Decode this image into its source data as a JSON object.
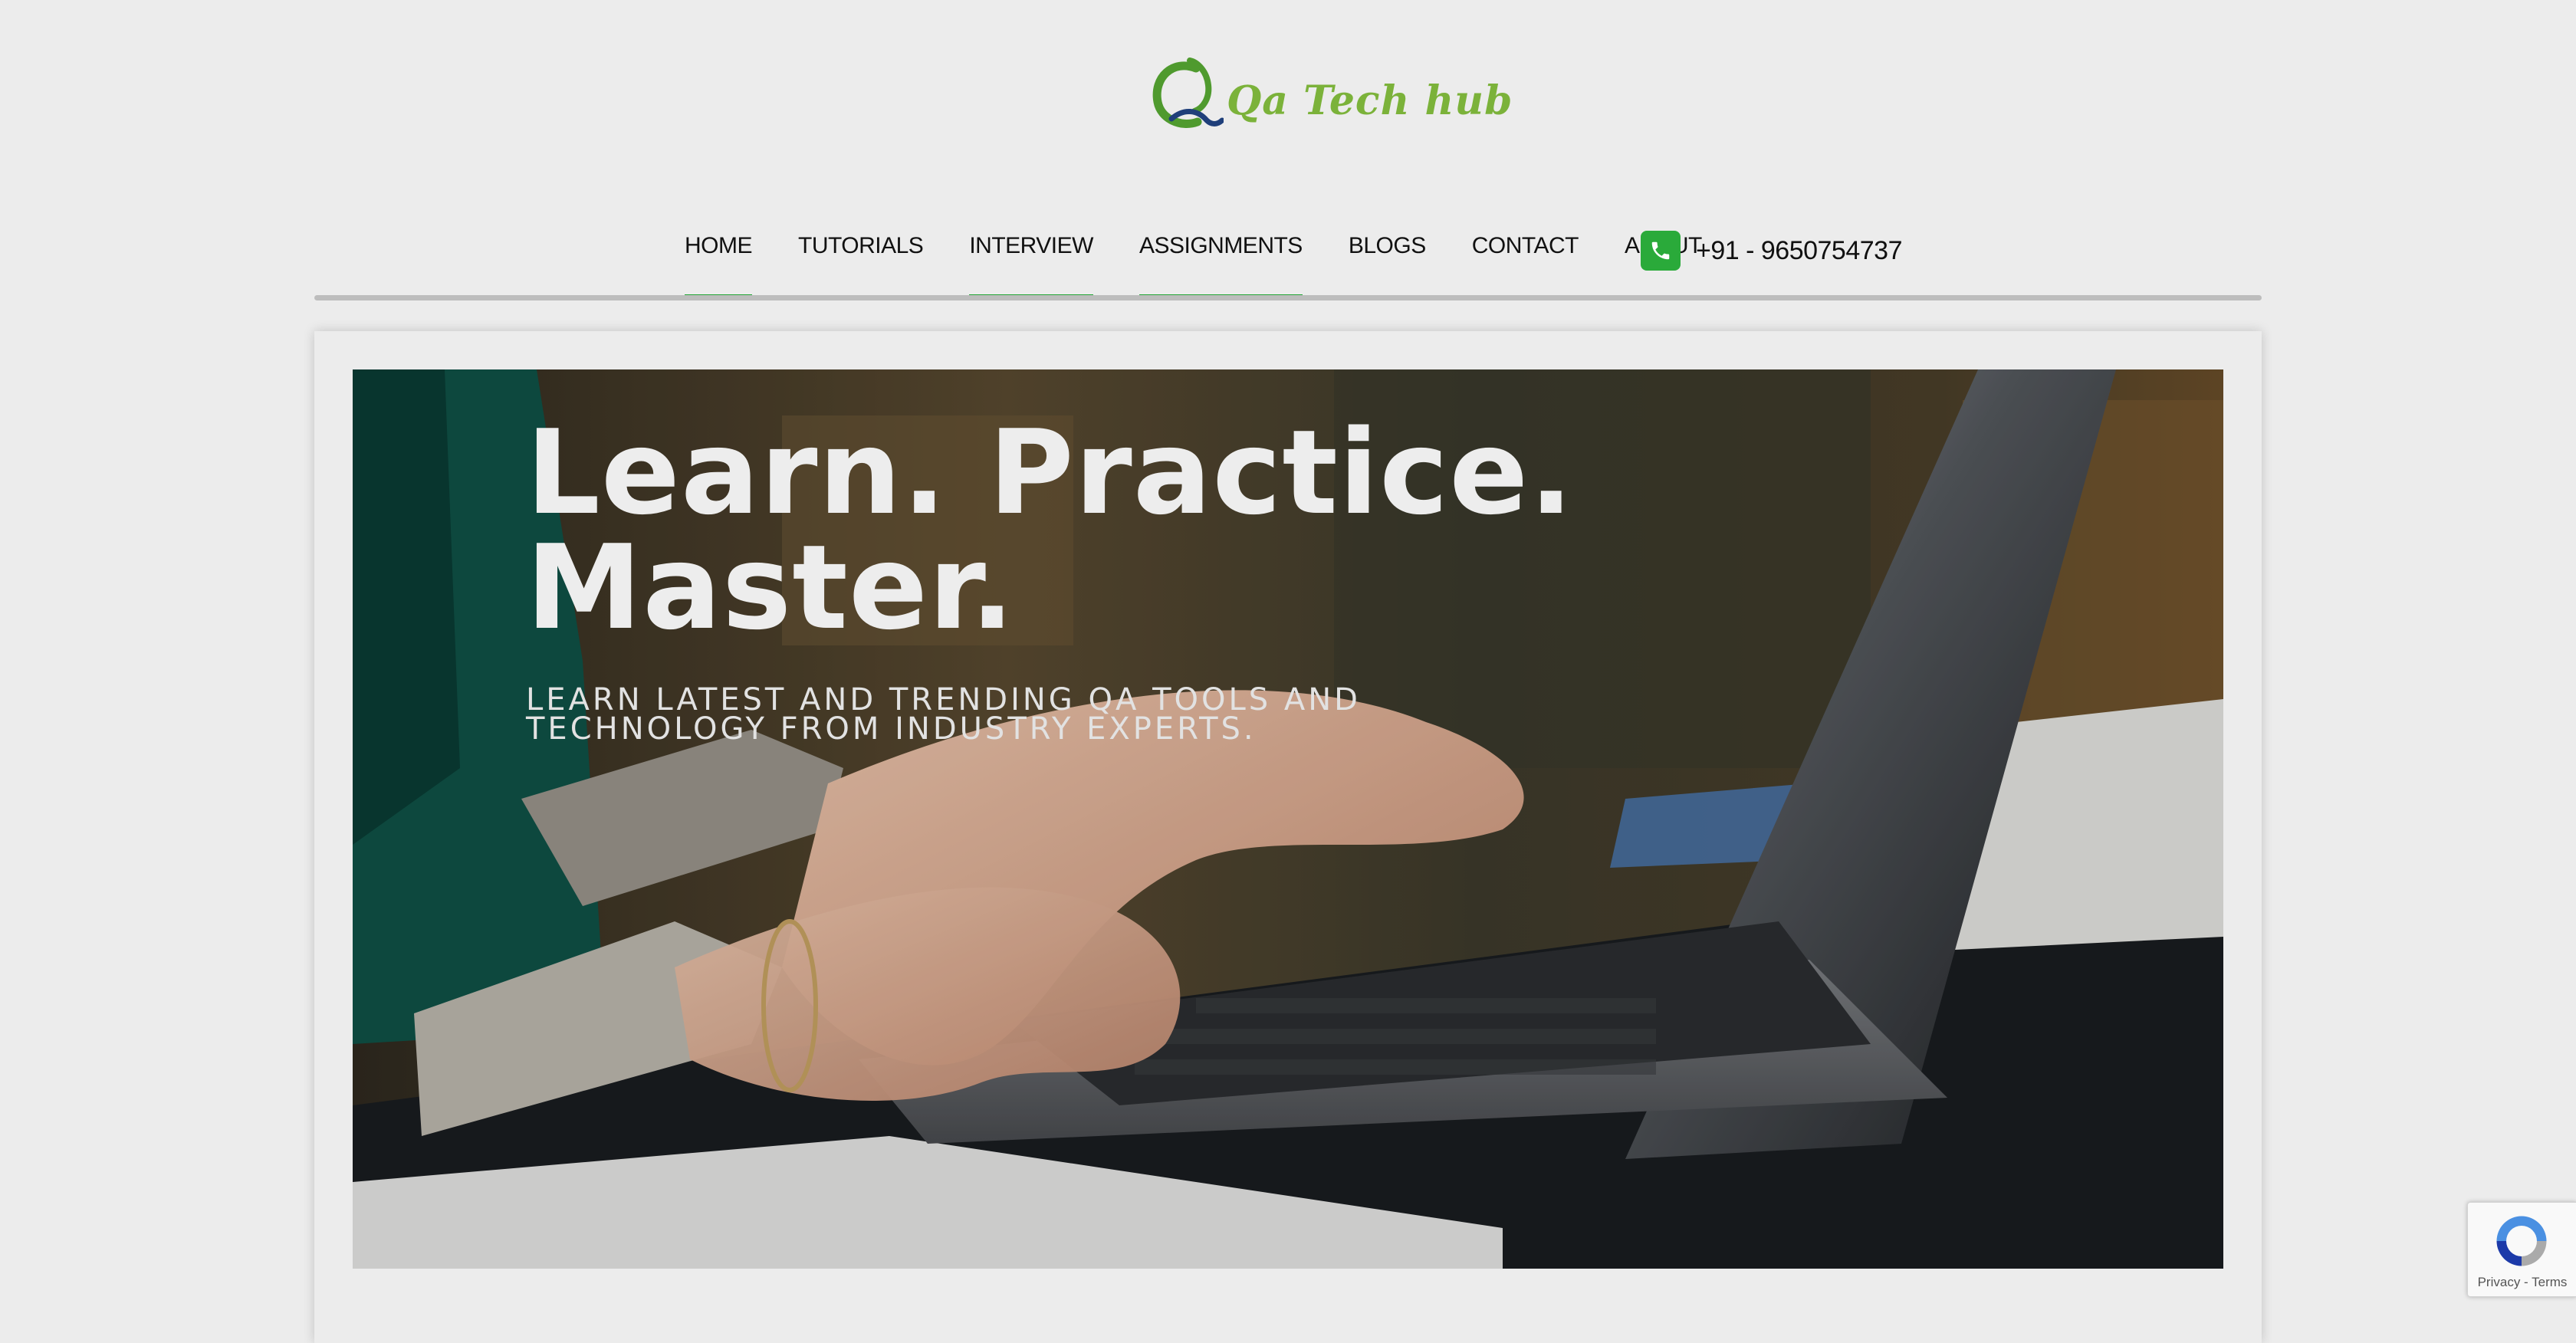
{
  "logo": {
    "text": "Qa Tech hub",
    "color": "#7bb23a",
    "mark_color_green": "#4f9a2e",
    "mark_color_blue": "#1f3f7a"
  },
  "nav": {
    "items": [
      {
        "label": "HOME",
        "active": true
      },
      {
        "label": "TUTORIALS",
        "active": false
      },
      {
        "label": "INTERVIEW",
        "active": true
      },
      {
        "label": "ASSIGNMENTS",
        "active": true
      },
      {
        "label": "BLOGS",
        "active": false
      },
      {
        "label": "CONTACT",
        "active": false
      },
      {
        "label": "ABOUT",
        "active": false
      }
    ],
    "accent_color": "#22a535",
    "phone_icon": "phone-icon",
    "phone": "+91 - 9650754737"
  },
  "hero": {
    "title_line1": "Learn. Practice.",
    "title_line2": "Master.",
    "subtitle": "LEARN LATEST AND TRENDING QA TOOLS AND TECHNOLOGY FROM INDUSTRY EXPERTS.",
    "image": "person typing on laptop"
  },
  "recaptcha": {
    "icon": "recaptcha-icon",
    "terms": "Privacy - Terms"
  }
}
